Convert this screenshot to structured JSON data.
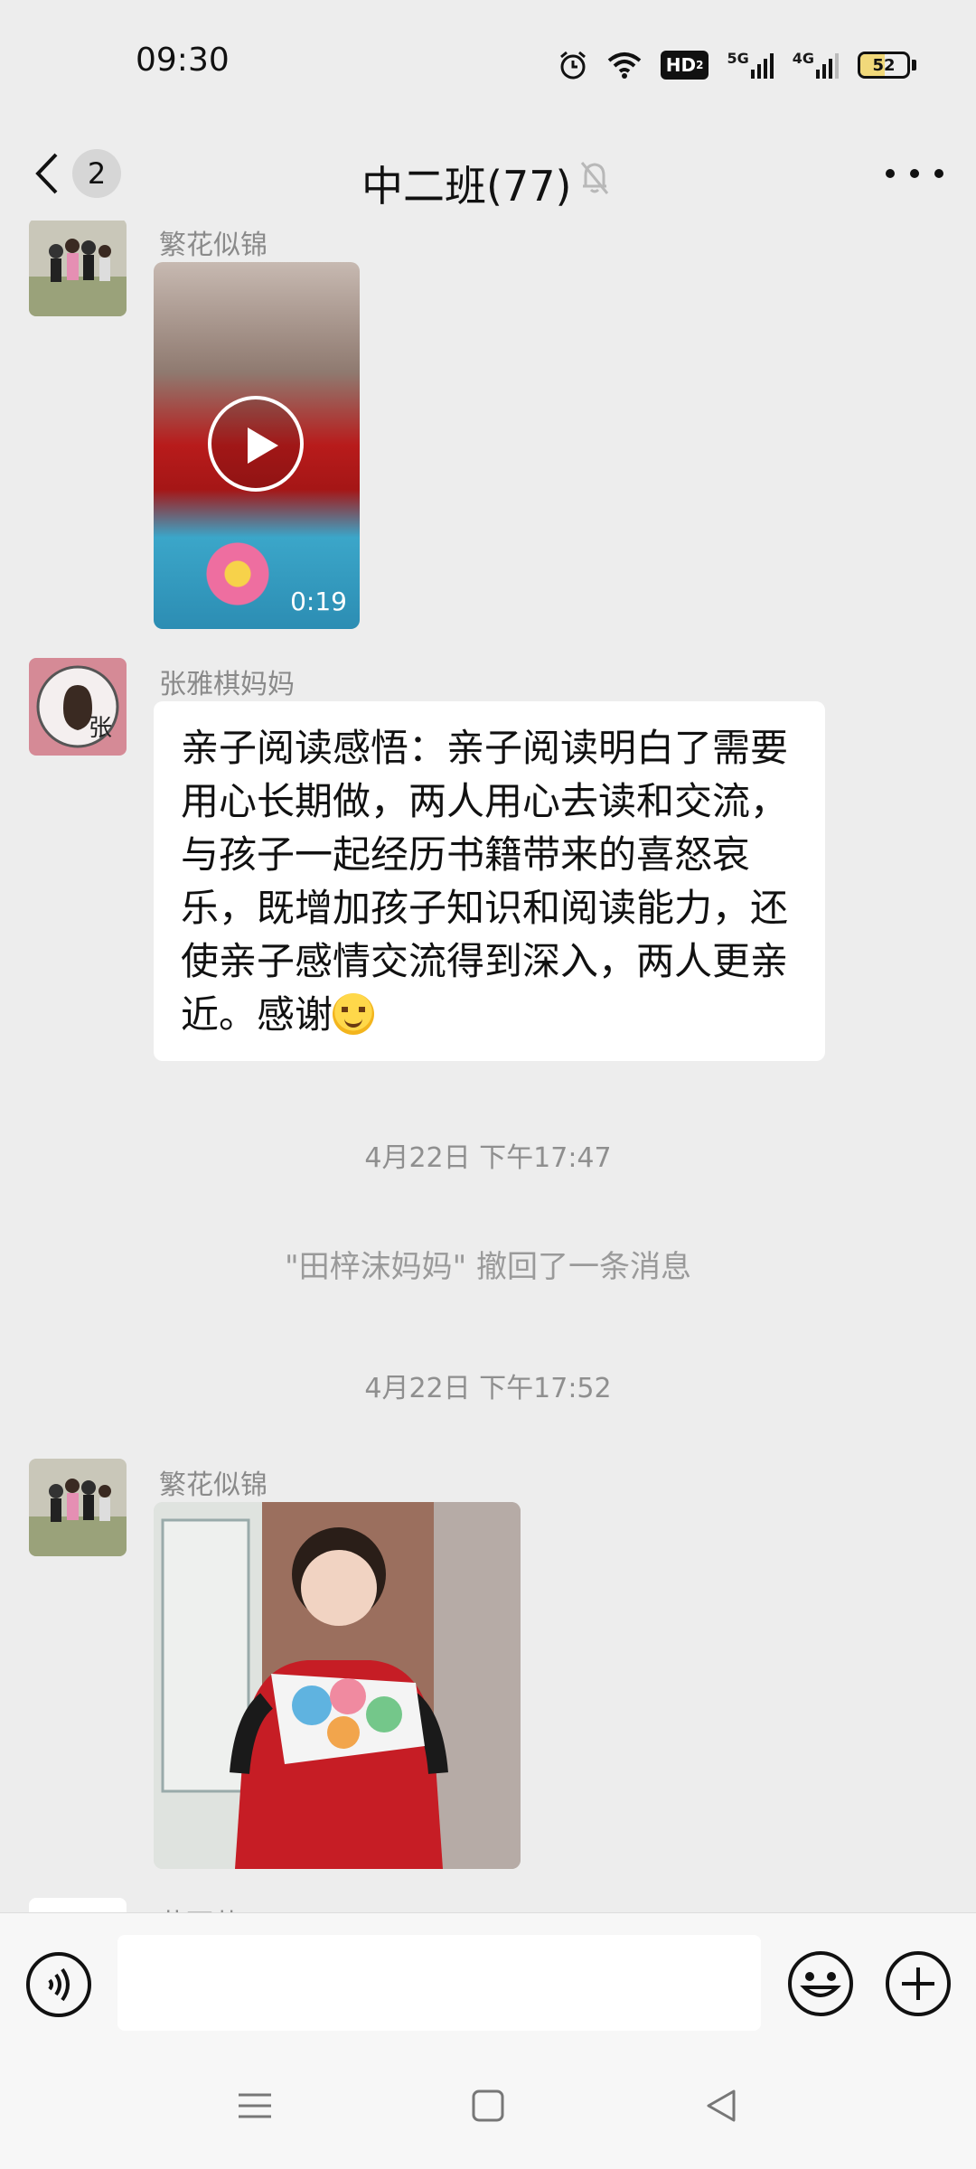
{
  "status_bar": {
    "time": "09:30",
    "hd_label": "HD",
    "hd_sub": "2",
    "signal1_label": "5G",
    "signal2_label": "4G",
    "battery_level": "52",
    "battery_fraction": 0.52
  },
  "header": {
    "back_count": "2",
    "title": "中二班(77)",
    "muted": true
  },
  "messages": [
    {
      "sender": "繁花似锦",
      "type": "video",
      "duration": "0:19"
    },
    {
      "sender": "张雅棋妈妈",
      "type": "text",
      "text": "亲子阅读感悟：亲子阅读明白了需要用心长期做，两人用心去读和交流，与孩子一起经历书籍带来的喜怒哀乐，既增加孩子知识和阅读能力，还使亲子感情交流得到深入，两人更亲近。感谢",
      "emoji": "smiling-face"
    },
    {
      "type": "timestamp",
      "text": "4月22日 下午17:47"
    },
    {
      "type": "system",
      "text": "\"田梓沫妈妈\" 撤回了一条消息"
    },
    {
      "type": "timestamp",
      "text": "4月22日 下午17:52"
    },
    {
      "sender": "繁花似锦",
      "type": "image"
    },
    {
      "sender": "黄西茜",
      "type": "partial"
    }
  ],
  "input_bar": {
    "placeholder": "",
    "value": ""
  },
  "icons": {
    "back": "chevron-left-icon",
    "mute": "bell-off-icon",
    "more": "more-dots-icon",
    "voice": "voice-icon",
    "emoji": "emoji-icon",
    "plus": "plus-icon",
    "nav_menu": "menu-icon",
    "nav_home": "home-square-icon",
    "nav_back": "triangle-back-icon"
  }
}
